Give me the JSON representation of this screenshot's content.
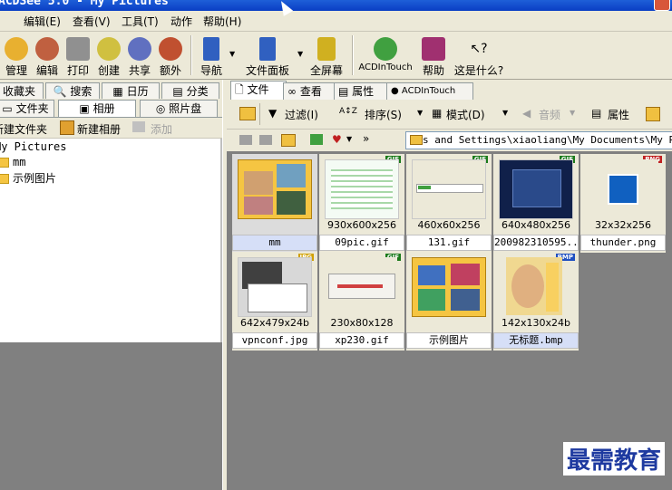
{
  "window": {
    "title": "ACDSee 5.0 - My Pictures"
  },
  "menu": [
    "编辑(E)",
    "查看(V)",
    "工具(T)",
    "动作",
    "帮助(H)"
  ],
  "toolbar": {
    "buttons": [
      "管理",
      "编辑",
      "打印",
      "创建",
      "共享",
      "额外",
      "导航",
      "文件面板",
      "全屏幕",
      "ACDInTouch",
      "帮助",
      "这是什么?"
    ]
  },
  "left": {
    "tabs_row1": [
      "收藏夹",
      "搜索",
      "日历",
      "分类"
    ],
    "tabs_row2": [
      "文件夹",
      "相册",
      "照片盘"
    ],
    "actions": {
      "new_folder": "新建文件夹",
      "new_album": "新建相册",
      "add": "添加"
    },
    "tree": {
      "root": "My Pictures",
      "children": [
        "mm",
        "示例图片"
      ]
    }
  },
  "right": {
    "tabs": [
      "文件",
      "查看",
      "属性",
      "ACDInTouch"
    ],
    "tools": {
      "filter": "过滤(I)",
      "sort": "排序(S)",
      "mode": "模式(D)",
      "audio": "音频",
      "properties": "属性"
    },
    "path": "s and Settings\\xiaoliang\\My Documents\\My Pict",
    "thumbnails": [
      {
        "name": "mm",
        "dims": "",
        "badge": ""
      },
      {
        "name": "09pic.gif",
        "dims": "930x600x256",
        "badge": "GIF"
      },
      {
        "name": "131.gif",
        "dims": "460x60x256",
        "badge": "GIF"
      },
      {
        "name": "200982310595...",
        "dims": "640x480x256",
        "badge": "GIF"
      },
      {
        "name": "thunder.png",
        "dims": "32x32x256",
        "badge": "PNG"
      },
      {
        "name": "vpnconf.jpg",
        "dims": "642x479x24b",
        "badge": "JPG"
      },
      {
        "name": "xp230.gif",
        "dims": "230x80x128",
        "badge": "GIF"
      },
      {
        "name": "示例图片",
        "dims": "",
        "badge": ""
      },
      {
        "name": "无标题.bmp",
        "dims": "142x130x24b",
        "badge": "BMP"
      }
    ]
  },
  "watermark": "最需教育"
}
